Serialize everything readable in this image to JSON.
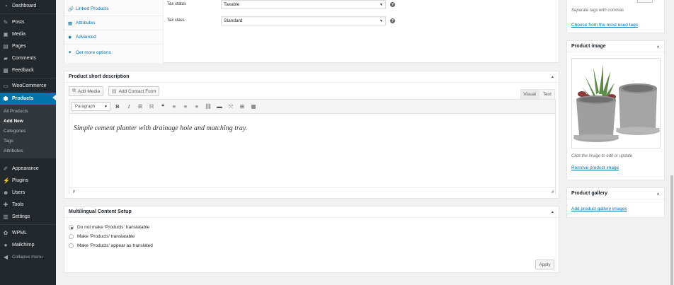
{
  "sidebar": {
    "items": [
      {
        "label": "Dashboard",
        "icon": "dashboard-icon"
      },
      {
        "label": "Posts",
        "icon": "pushpin-icon"
      },
      {
        "label": "Media",
        "icon": "media-icon"
      },
      {
        "label": "Pages",
        "icon": "pages-icon"
      },
      {
        "label": "Comments",
        "icon": "comment-icon"
      },
      {
        "label": "Feedback",
        "icon": "feedback-icon"
      },
      {
        "label": "WooCommerce",
        "icon": "woocommerce-icon"
      },
      {
        "label": "Products",
        "icon": "product-icon"
      },
      {
        "label": "Appearance",
        "icon": "brush-icon"
      },
      {
        "label": "Plugins",
        "icon": "plugin-icon"
      },
      {
        "label": "Users",
        "icon": "users-icon"
      },
      {
        "label": "Tools",
        "icon": "wrench-icon"
      },
      {
        "label": "Settings",
        "icon": "settings-icon"
      },
      {
        "label": "WPML",
        "icon": "wpml-icon"
      },
      {
        "label": "Mailchimp",
        "icon": "mailchimp-icon"
      },
      {
        "label": "Collapse menu",
        "icon": "collapse-icon"
      }
    ],
    "submenu": [
      "All Products",
      "Add New",
      "Categories",
      "Tags",
      "Attributes"
    ],
    "current_item": "Products",
    "current_subitem": "Add New"
  },
  "product_data": {
    "tabs": [
      {
        "label": "Linked Products",
        "icon": "link-icon"
      },
      {
        "label": "Attributes",
        "icon": "table-icon"
      },
      {
        "label": "Advanced",
        "icon": "gear-icon"
      },
      {
        "label": "Get more options",
        "icon": "plugin-icon"
      }
    ],
    "tax_status_label": "Tax status",
    "tax_status_value": "Taxable",
    "tax_class_label": "Tax class",
    "tax_class_value": "Standard"
  },
  "short_description": {
    "title": "Product short description",
    "add_media": "Add Media",
    "add_contact_form": "Add Contact Form",
    "tab_visual": "Visual",
    "tab_text": "Text",
    "format_select": "Paragraph",
    "content": "Simple cement planter with drainage hole and matching tray.",
    "status_path": "p"
  },
  "multilingual": {
    "title": "Multilingual Content Setup",
    "options": [
      "Do not make 'Products' translatable",
      "Make 'Products' translatable",
      "Make 'Products' appear as translated"
    ],
    "selected_index": 0,
    "apply": "Apply"
  },
  "tags": {
    "note": "Separate tags with commas",
    "choose_link": "Choose from the most used tags"
  },
  "product_image": {
    "title": "Product image",
    "caption": "Click the image to edit or update",
    "remove_link": "Remove product image"
  },
  "product_gallery": {
    "title": "Product gallery",
    "add_link": "Add product gallery images"
  },
  "colors": {
    "sidebar_bg": "#23282d",
    "accent": "#0073aa",
    "page_bg": "#f1f1f1"
  }
}
